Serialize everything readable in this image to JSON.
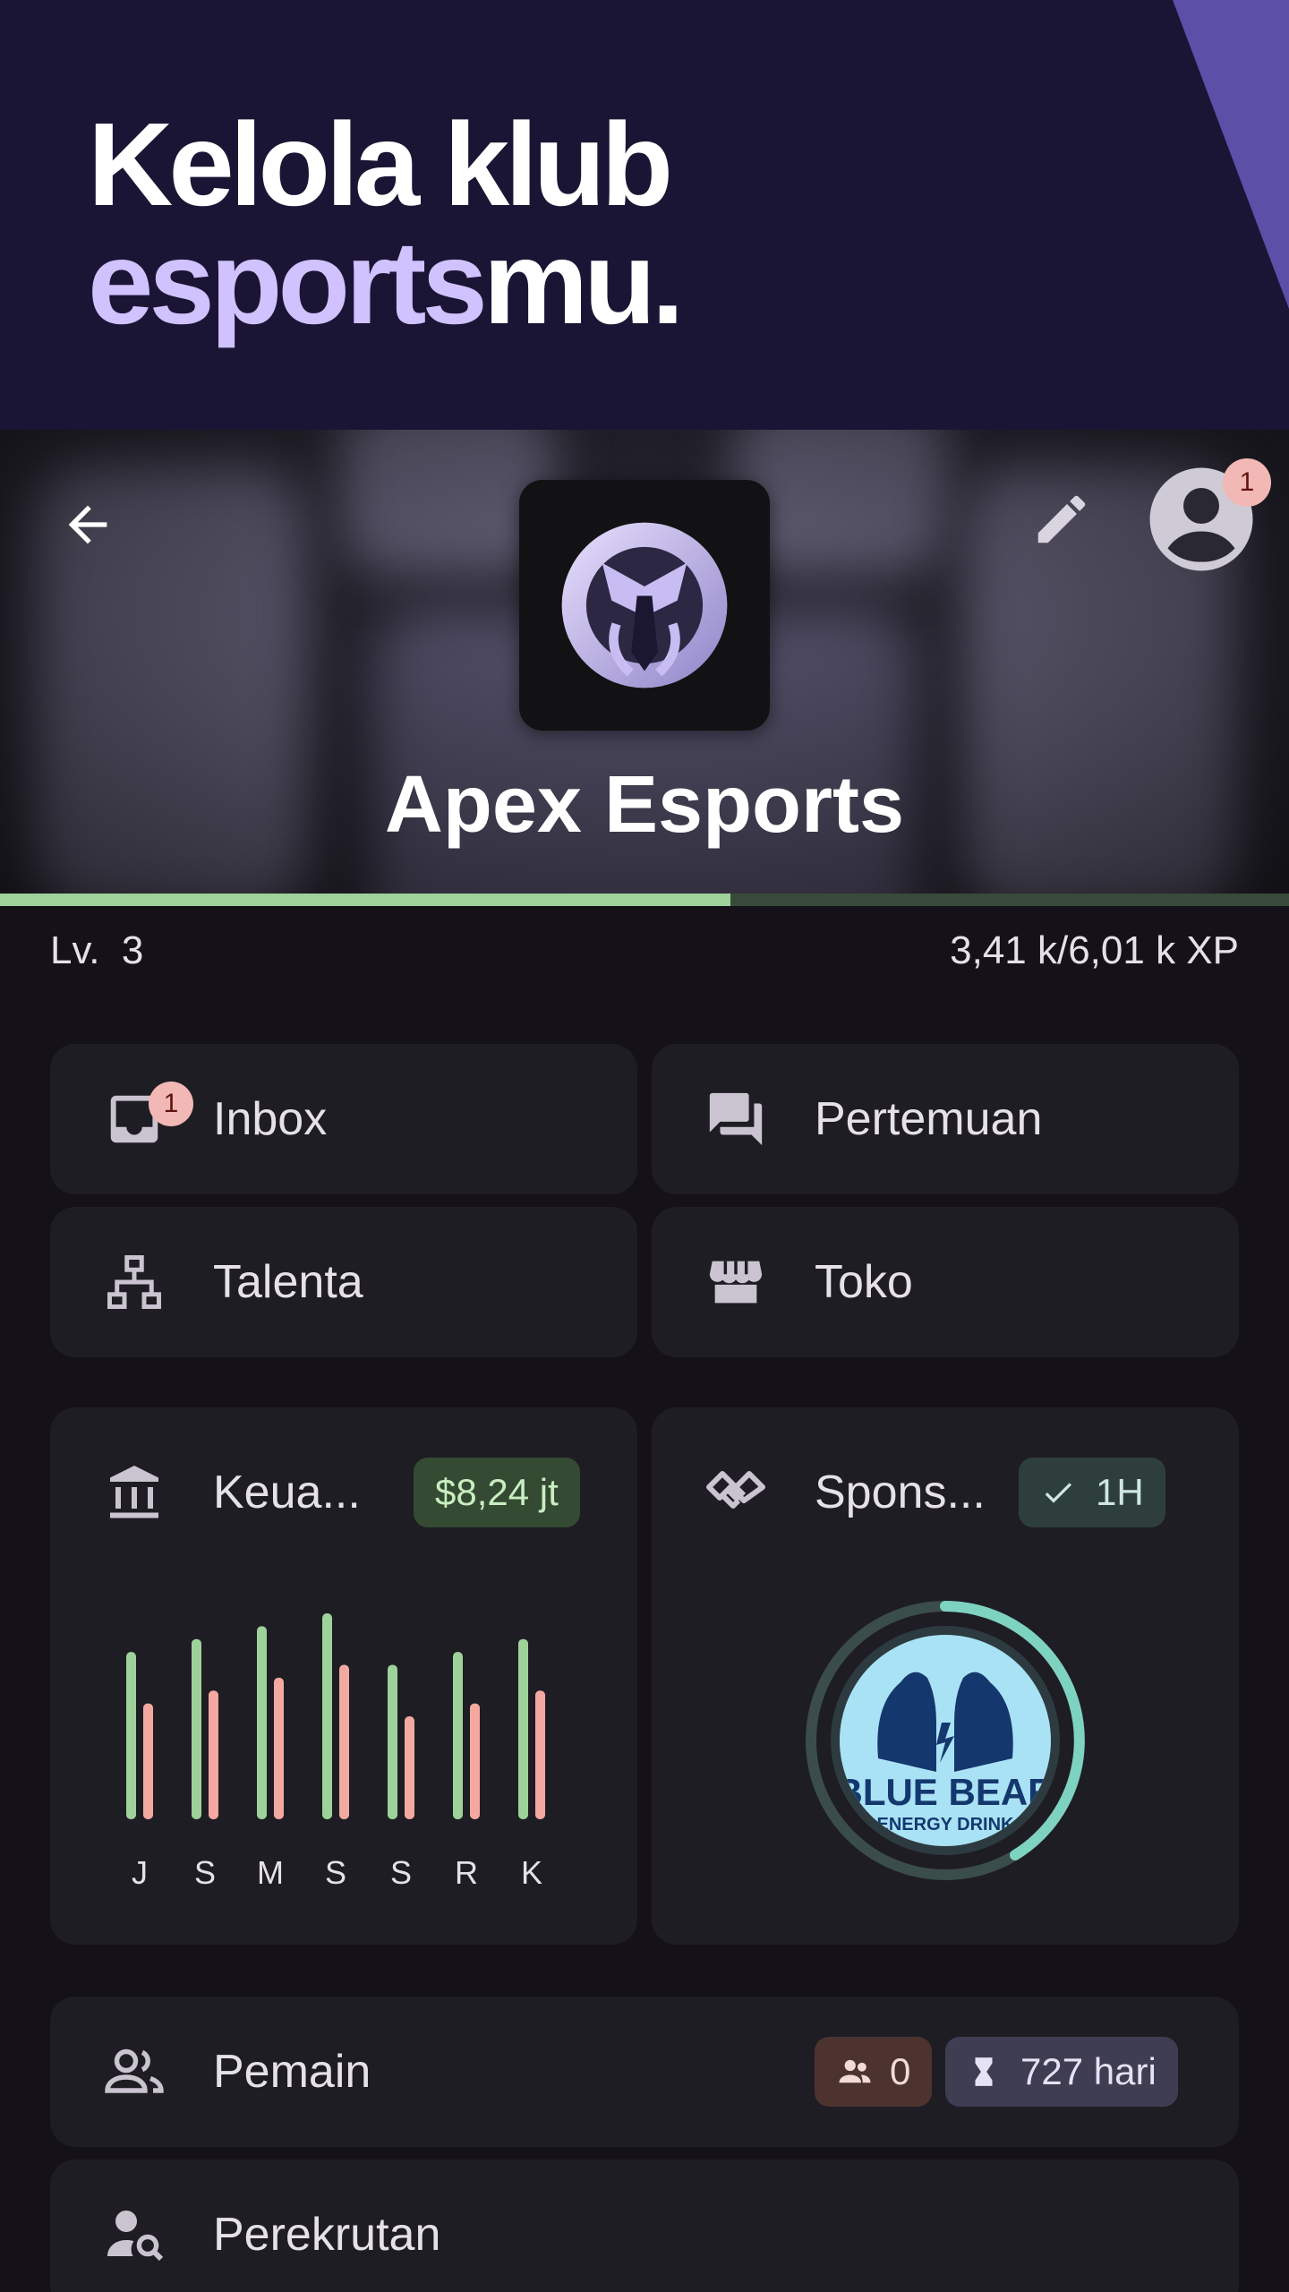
{
  "promo": {
    "line1": "Kelola klub",
    "line2_accent": "esports",
    "line2_rest": "mu."
  },
  "header": {
    "club_name": "Apex Esports",
    "profile_badge": "1"
  },
  "xp": {
    "level_label": "Lv.  3",
    "progress_text": "3,41 k/6,01 k XP",
    "progress_fraction": 0.567
  },
  "nav": {
    "inbox": {
      "label": "Inbox",
      "badge": "1"
    },
    "meetings": {
      "label": "Pertemuan"
    },
    "talent": {
      "label": "Talenta"
    },
    "shop": {
      "label": "Toko"
    }
  },
  "finance": {
    "label": "Keua...",
    "chip": "$8,24 jt",
    "colors": {
      "income": "#9ed29a",
      "expense": "#f4a9a0"
    }
  },
  "chart_data": {
    "type": "bar",
    "categories": [
      "J",
      "S",
      "M",
      "S",
      "S",
      "R",
      "K"
    ],
    "series": [
      {
        "values": [
          13,
          14,
          15,
          16,
          12,
          13,
          14
        ]
      },
      {
        "values": [
          9,
          10,
          11,
          12,
          8,
          9,
          10
        ]
      }
    ],
    "ylim": [
      0,
      16
    ],
    "grid": false
  },
  "sponsor": {
    "label": "Spons...",
    "chip": "1H",
    "logo_text_1": "BLUE BEAR",
    "logo_text_2": "ENERGY DRINK"
  },
  "players": {
    "label": "Pemain",
    "count_chip": "0",
    "days_chip": "727 hari"
  },
  "recruitment": {
    "label": "Perekrutan"
  }
}
